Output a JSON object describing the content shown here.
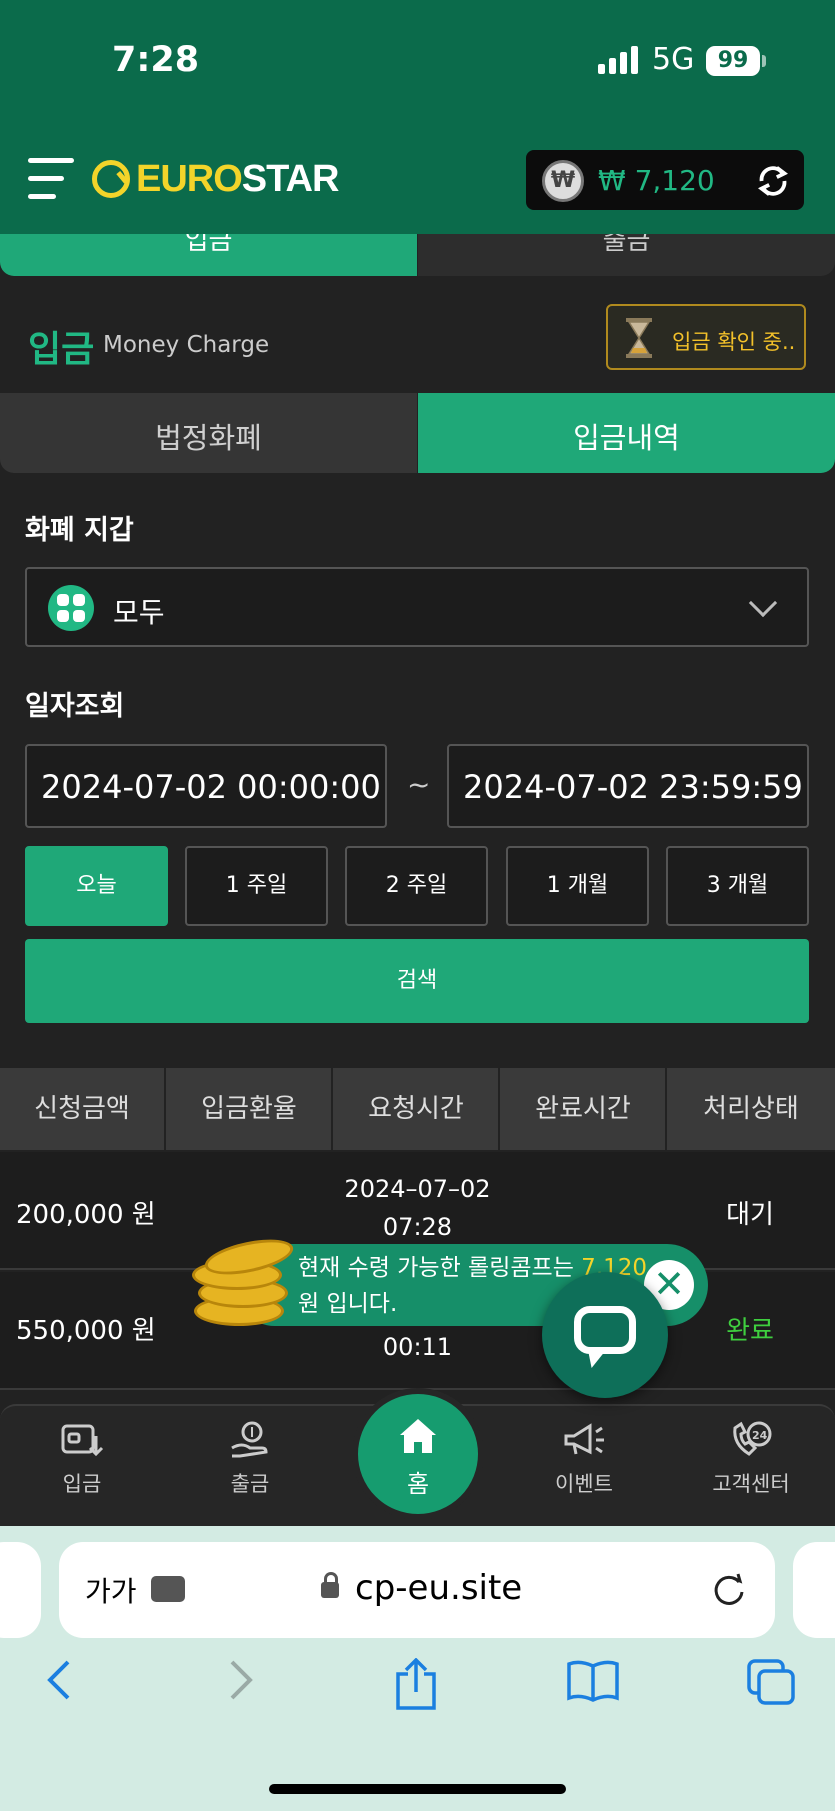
{
  "status": {
    "time": "7:28",
    "network": "5G",
    "battery": "99"
  },
  "header": {
    "logo_part1": "EURO",
    "logo_part2": "STAR",
    "wallet_amount": "₩ 7,120",
    "currency_symbol": "₩"
  },
  "top_tabs": [
    "입금",
    "출금"
  ],
  "heading": {
    "title": "입금",
    "subtitle": "Money Charge",
    "confirm_label": "입금 확인 중.."
  },
  "segments": [
    "법정화폐",
    "입금내역"
  ],
  "wallet_label": "화폐 지갑",
  "wallet_select_value": "모두",
  "date_label": "일자조회",
  "date_from": "2024-07-02 00:00:00",
  "date_to": "2024-07-02 23:59:59",
  "date_separator": "~",
  "quick_ranges": [
    "오늘",
    "1 주일",
    "2 주일",
    "1 개월",
    "3 개월"
  ],
  "search_label": "검색",
  "table": {
    "headers": [
      "신청금액",
      "입금환율",
      "요청시간",
      "완료시간",
      "처리상태"
    ],
    "rows": [
      {
        "amount": "200,000 원",
        "time_date": "2024–07–02",
        "time_clock": "07:28",
        "status": "대기"
      },
      {
        "amount": "550,000 원",
        "time_date": "",
        "time_clock": "00:11",
        "status": "완료"
      }
    ]
  },
  "toast": {
    "text_a": "현재 수령 가능한 롤링콤프는 ",
    "highlight": "7,120",
    "text_b": "원 입니다.",
    "close": "✕"
  },
  "bottom_nav": [
    "입금",
    "출금",
    "홈",
    "이벤트",
    "고객센터"
  ],
  "browser": {
    "text_size": "가가",
    "url": "cp-eu.site"
  },
  "colors": {
    "primary": "#1fa878",
    "header": "#0b6b4b",
    "status_waiting": "#ffffff",
    "status_done": "#3fcf3f"
  }
}
